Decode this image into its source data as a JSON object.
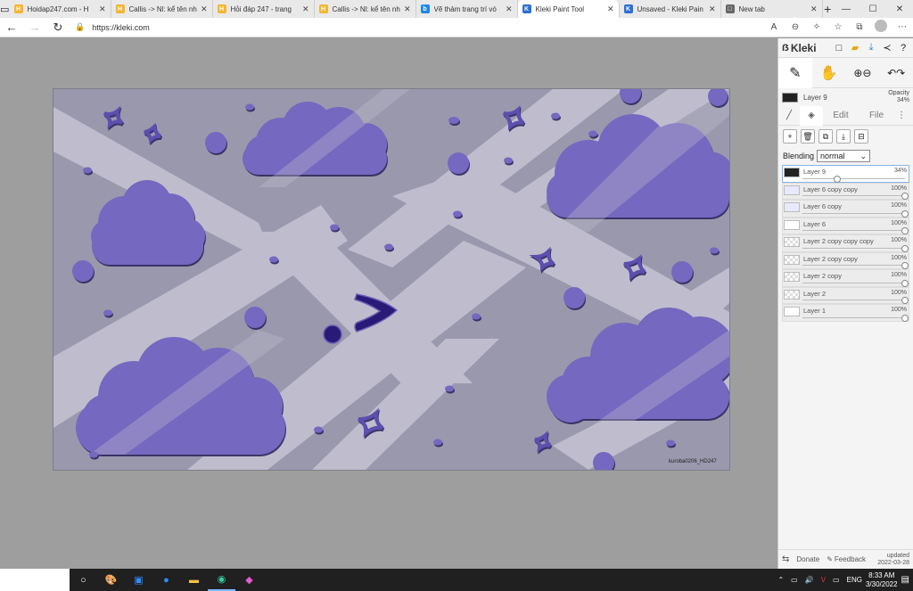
{
  "tabs": [
    {
      "label": "Hoidap247.com - H",
      "fav_color": "#f3b531",
      "fav_glyph": "H"
    },
    {
      "label": "Callis -> Nl: kể tên nh",
      "fav_color": "#f3b531",
      "fav_glyph": "H"
    },
    {
      "label": "Hỏi đáp 247 - trang",
      "fav_color": "#f3b531",
      "fav_glyph": "H"
    },
    {
      "label": "Callis -> Nl: kể tên nh",
      "fav_color": "#f3b531",
      "fav_glyph": "H"
    },
    {
      "label": "Vẽ thảm trang trí vó",
      "fav_color": "#1e88e5",
      "fav_glyph": "b"
    },
    {
      "label": "Kleki Paint Tool",
      "fav_color": "#2c6fd6",
      "fav_glyph": "K",
      "active": true
    },
    {
      "label": "Unsaved - Kleki Pain",
      "fav_color": "#2c6fd6",
      "fav_glyph": "K"
    },
    {
      "label": "New tab",
      "fav_color": "#666666",
      "fav_glyph": "□"
    }
  ],
  "address": {
    "url": "https://kleki.com"
  },
  "canvas": {
    "watermark": "kuroba0206_HD247",
    "bg_color": "#9a98ad",
    "stripe_color": "#bfbdcd",
    "cloud_color": "#7468c0",
    "accent_dark": "#2a1a78"
  },
  "panel": {
    "brand": "Kleki",
    "current_layer": "Layer 9",
    "opacity_label": "Opacity",
    "opacity_value": "34%",
    "tab_edit": "Edit",
    "tab_file": "File",
    "blending_label": "Blending",
    "blending_value": "normal",
    "layers": [
      {
        "name": "Layer 9",
        "opacity": "34%",
        "thumb": "dark",
        "selected": true,
        "level": 0.34
      },
      {
        "name": "Layer 6 copy copy",
        "opacity": "100%",
        "thumb": "blue",
        "level": 1
      },
      {
        "name": "Layer 6 copy",
        "opacity": "100%",
        "thumb": "blue",
        "level": 1
      },
      {
        "name": "Layer 6",
        "opacity": "100%",
        "thumb": "bw",
        "level": 1
      },
      {
        "name": "Layer 2 copy copy copy",
        "opacity": "100%",
        "thumb": "chk",
        "level": 1
      },
      {
        "name": "Layer 2 copy copy",
        "opacity": "100%",
        "thumb": "chk",
        "level": 1
      },
      {
        "name": "Layer 2 copy",
        "opacity": "100%",
        "thumb": "chk",
        "level": 1
      },
      {
        "name": "Layer 2",
        "opacity": "100%",
        "thumb": "chk",
        "level": 1
      },
      {
        "name": "Layer 1",
        "opacity": "100%",
        "thumb": "white",
        "level": 1
      }
    ],
    "footer": {
      "donate": "Donate",
      "feedback": "Feedback",
      "updated_label": "updated",
      "updated_date": "2022-03-28"
    }
  },
  "taskbar": {
    "lang": "ENG",
    "time": "8:33 AM",
    "date": "3/30/2022"
  }
}
